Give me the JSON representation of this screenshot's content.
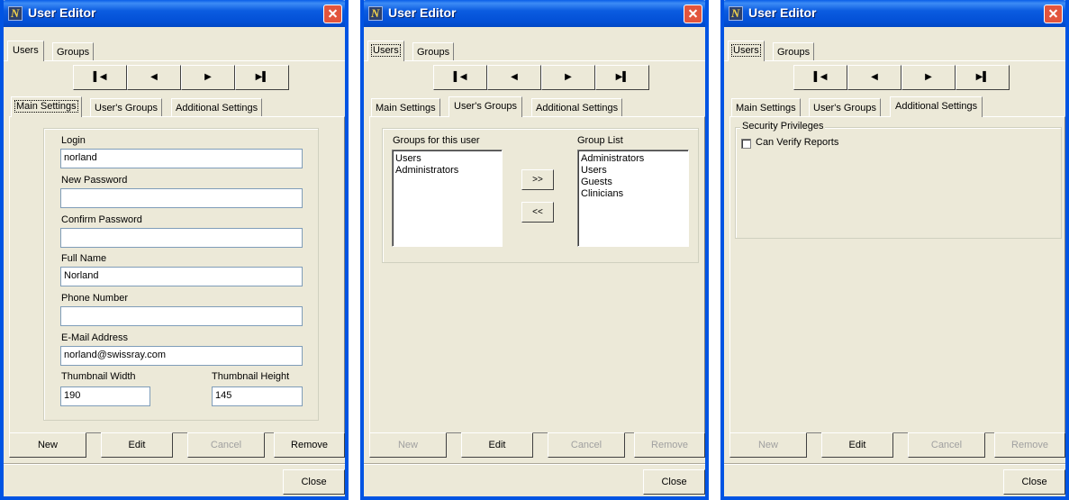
{
  "windows": [
    {
      "title": "User Editor",
      "top_tabs": [
        "Users",
        "Groups"
      ],
      "nav": [
        "first",
        "prev",
        "next",
        "last"
      ],
      "sub_tabs": [
        "Main Settings",
        "User's Groups",
        "Additional Settings"
      ],
      "main_settings": {
        "login_label": "Login",
        "login_value": "norland",
        "new_password_label": "New Password",
        "new_password_value": "",
        "confirm_password_label": "Confirm Password",
        "confirm_password_value": "",
        "full_name_label": "Full Name",
        "full_name_value": "Norland",
        "phone_label": "Phone Number",
        "phone_value": "",
        "email_label": "E-Mail Address",
        "email_value": "norland@swissray.com",
        "thumb_width_label": "Thumbnail Width",
        "thumb_width_value": "190",
        "thumb_height_label": "Thumbnail Height",
        "thumb_height_value": "145"
      },
      "buttons": {
        "new": "New",
        "edit": "Edit",
        "cancel": "Cancel",
        "remove": "Remove",
        "close": "Close"
      }
    },
    {
      "title": "User Editor",
      "top_tabs": [
        "Users",
        "Groups"
      ],
      "sub_tabs": [
        "Main Settings",
        "User's Groups",
        "Additional Settings"
      ],
      "users_groups": {
        "groups_for_user_label": "Groups for this user",
        "groups_for_user": [
          "Users",
          "Administrators"
        ],
        "group_list_label": "Group List",
        "group_list": [
          "Administrators",
          "Users",
          "Guests",
          "Clinicians"
        ],
        "add_label": ">>",
        "remove_label": "<<"
      },
      "buttons": {
        "new": "New",
        "edit": "Edit",
        "cancel": "Cancel",
        "remove": "Remove",
        "close": "Close"
      }
    },
    {
      "title": "User Editor",
      "top_tabs": [
        "Users",
        "Groups"
      ],
      "sub_tabs": [
        "Main Settings",
        "User's Groups",
        "Additional Settings"
      ],
      "additional": {
        "security_label": "Security Privileges",
        "can_verify_label": "Can Verify Reports"
      },
      "buttons": {
        "new": "New",
        "edit": "Edit",
        "cancel": "Cancel",
        "remove": "Remove",
        "close": "Close"
      }
    }
  ],
  "icons": {
    "first": "skip-first-icon",
    "prev": "prev-icon",
    "next": "next-icon",
    "last": "skip-last-icon"
  }
}
